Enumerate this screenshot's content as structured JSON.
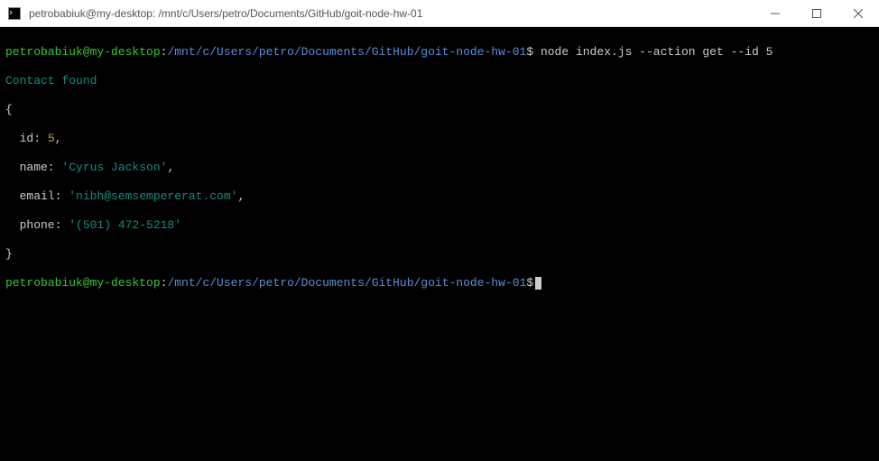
{
  "window": {
    "title": "petrobabiuk@my-desktop: /mnt/c/Users/petro/Documents/GitHub/goit-node-hw-01"
  },
  "prompt": {
    "user_host": "petrobabiuk@my-desktop",
    "colon": ":",
    "cwd": "/mnt/c/Users/petro/Documents/GitHub/goit-node-hw-01",
    "sigil": "$"
  },
  "command": "node index.js --action get --id 5",
  "output": {
    "message": "Contact found",
    "open_brace": "{",
    "close_brace": "}",
    "fields": {
      "id_key": "  id: ",
      "id_val": "5",
      "comma": ",",
      "name_key": "  name: ",
      "name_val": "'Cyrus Jackson'",
      "email_key": "  email: ",
      "email_val": "'nibh@semsempererat.com'",
      "phone_key": "  phone: ",
      "phone_val": "'(501) 472-5218'"
    }
  }
}
